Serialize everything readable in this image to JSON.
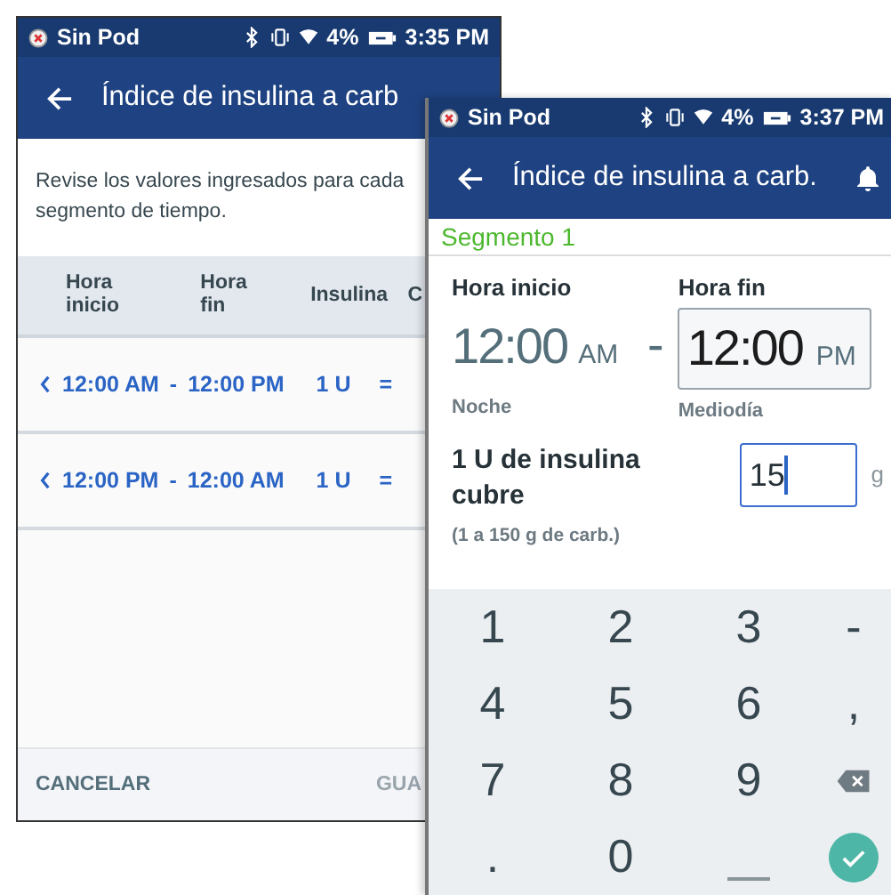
{
  "back_screen": {
    "status": {
      "carrier": "Sin Pod",
      "battery": "4%",
      "time": "3:35 PM"
    },
    "title": "Índice de insulina a carb",
    "intro": "Revise los valores ingresados para cada segmento de tiempo.",
    "columns": [
      "Hora inicio",
      "Hora fin",
      "Insulina",
      "C"
    ],
    "rows": [
      {
        "start": "12:00 AM",
        "dash": "-",
        "end": "12:00 PM",
        "insulin": "1 U",
        "equals": "="
      },
      {
        "start": "12:00 PM",
        "dash": "-",
        "end": "12:00 AM",
        "insulin": "1 U",
        "equals": "="
      }
    ],
    "cancel": "CANCELAR",
    "save": {
      "label": "GUA",
      "disabled": true
    }
  },
  "front_screen": {
    "status": {
      "carrier": "Sin Pod",
      "battery": "4%",
      "time": "3:37 PM"
    },
    "title": "Índice de insulina a carb.",
    "segment": "Segmento 1",
    "start": {
      "label": "Hora inicio",
      "time": "12:00",
      "period": "AM",
      "note": "Noche"
    },
    "separator": "-",
    "end": {
      "label": "Hora fin",
      "time": "12:00",
      "period": "PM",
      "note": "Mediodía"
    },
    "ratio": {
      "label": "1 U de insulina cubre",
      "range": "(1 a 150 g de carb.)",
      "value": "15",
      "unit": "g"
    },
    "keys": [
      {
        "kind": "char",
        "label": "1"
      },
      {
        "kind": "char",
        "label": "2"
      },
      {
        "kind": "char",
        "label": "3"
      },
      {
        "kind": "char",
        "label": "-"
      },
      {
        "kind": "char",
        "label": "4"
      },
      {
        "kind": "char",
        "label": "5"
      },
      {
        "kind": "char",
        "label": "6"
      },
      {
        "kind": "char",
        "label": ","
      },
      {
        "kind": "char",
        "label": "7"
      },
      {
        "kind": "char",
        "label": "8"
      },
      {
        "kind": "char",
        "label": "9"
      },
      {
        "kind": "backspace"
      },
      {
        "kind": "char",
        "label": "."
      },
      {
        "kind": "char",
        "label": "0"
      },
      {
        "kind": "space"
      },
      {
        "kind": "done"
      }
    ]
  }
}
